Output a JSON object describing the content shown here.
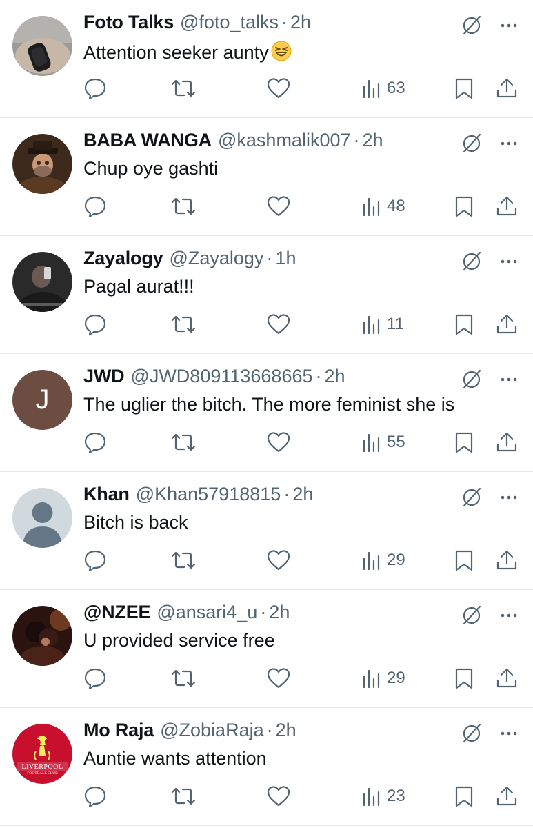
{
  "tweets": [
    {
      "name": "Foto Talks",
      "handle": "@foto_talks",
      "dot": "·",
      "time": "2h",
      "text": "Attention seeker aunty",
      "emoji": "grinning-squinting-face",
      "views": "63",
      "avatar": "watch-photo"
    },
    {
      "name": "BABA WANGA",
      "handle": "@kashmalik007",
      "dot": "·",
      "time": "2h",
      "text": "Chup oye gashti",
      "views": "48",
      "avatar": "man-with-hat-photo"
    },
    {
      "name": "Zayalogy",
      "handle": "@Zayalogy",
      "dot": "·",
      "time": "1h",
      "text": "Pagal aurat!!!",
      "views": "11",
      "avatar": "dark-selfie-photo"
    },
    {
      "name": "JWD",
      "handle": "@JWD809113668665",
      "dot": "·",
      "time": "2h",
      "text": "The uglier the bitch. The more feminist she is",
      "views": "55",
      "avatar": "letter-avatar",
      "avatar_letter": "J"
    },
    {
      "name": "Khan",
      "handle": "@Khan57918815",
      "dot": "·",
      "time": "2h",
      "text": "Bitch is back",
      "views": "29",
      "avatar": "default-avatar"
    },
    {
      "name": "@NZEE",
      "handle": "@ansari4_u",
      "dot": "·",
      "time": "2h",
      "text": "U provided service free",
      "views": "29",
      "avatar": "couple-photo"
    },
    {
      "name": "Mo Raja",
      "handle": "@ZobiaRaja",
      "dot": "·",
      "time": "2h",
      "text": "Auntie wants attention",
      "views": "23",
      "avatar": "liverpool-crest",
      "avatar_text": "LIVERPOOL",
      "avatar_subtext": "FOOTBALL CLUB"
    }
  ],
  "colors": {
    "text": "#0f1419",
    "secondary": "#536471",
    "divider": "#e6e9eb",
    "jwd_avatar": "#6d4c41",
    "liverpool_red": "#c8102e"
  },
  "icons": [
    "reply-icon",
    "retweet-icon",
    "like-icon",
    "views-icon",
    "bookmark-icon",
    "share-icon",
    "grok-icon",
    "more-icon"
  ]
}
